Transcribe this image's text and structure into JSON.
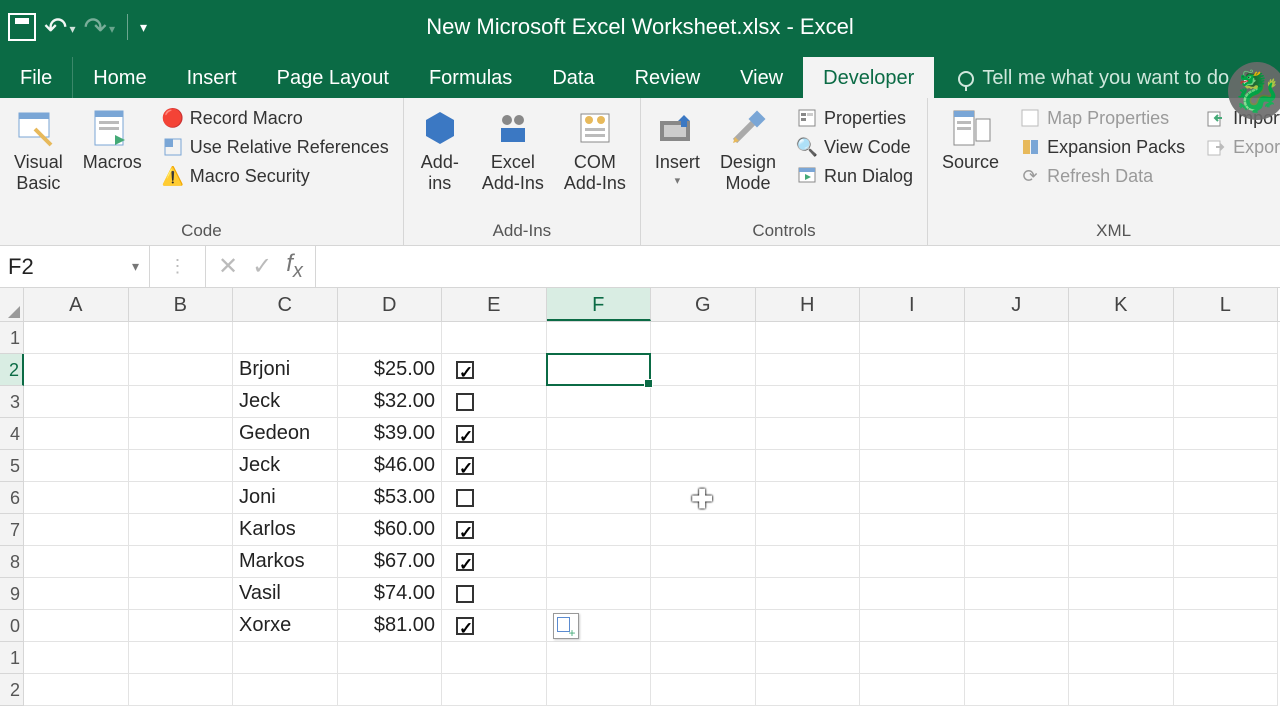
{
  "titlebar": {
    "title": "New Microsoft Excel Worksheet.xlsx - Excel"
  },
  "tabs": {
    "file": "File",
    "items": [
      "Home",
      "Insert",
      "Page Layout",
      "Formulas",
      "Data",
      "Review",
      "View",
      "Developer"
    ],
    "active": "Developer",
    "tellme": "Tell me what you want to do"
  },
  "ribbon": {
    "code": {
      "label": "Code",
      "visual_basic": "Visual\nBasic",
      "macros": "Macros",
      "record_macro": " Record Macro",
      "use_relative": " Use Relative References",
      "macro_sec": " Macro Security"
    },
    "addins": {
      "label": "Add-Ins",
      "addins": "Add-\nins",
      "excel": "Excel\nAdd-Ins",
      "com": "COM\nAdd-Ins"
    },
    "controls": {
      "label": "Controls",
      "insert": "Insert",
      "design": "Design\nMode",
      "properties": " Properties",
      "view_code": " View Code",
      "run_dialog": " Run Dialog"
    },
    "xml": {
      "label": "XML",
      "source": "Source",
      "map_props": " Map Properties",
      "expansion": " Expansion Packs",
      "refresh": " Refresh Data",
      "import": " Import",
      "export": " Export"
    }
  },
  "namebox": "F2",
  "formula": "",
  "columns": [
    "A",
    "B",
    "C",
    "D",
    "E",
    "F",
    "G",
    "H",
    "I",
    "J",
    "K",
    "L"
  ],
  "rows_visible": 12,
  "selected_col": "F",
  "selected_row": 2,
  "rowheads": [
    "1",
    "2",
    "3",
    "4",
    "5",
    "6",
    "7",
    "8",
    "9",
    "0",
    "1",
    "2"
  ],
  "data": {
    "names": [
      "Brjoni",
      "Jeck",
      "Gedeon",
      "Jeck",
      "Joni",
      "Karlos",
      "Markos",
      "Vasil",
      "Xorxe"
    ],
    "amounts": [
      "$25.00",
      "$32.00",
      "$39.00",
      "$46.00",
      "$53.00",
      "$60.00",
      "$67.00",
      "$74.00",
      "$81.00"
    ],
    "checks": [
      true,
      false,
      true,
      true,
      false,
      true,
      true,
      false,
      true
    ]
  },
  "paste_options_row": 10,
  "cursor": {
    "col": "G",
    "row": 6
  }
}
